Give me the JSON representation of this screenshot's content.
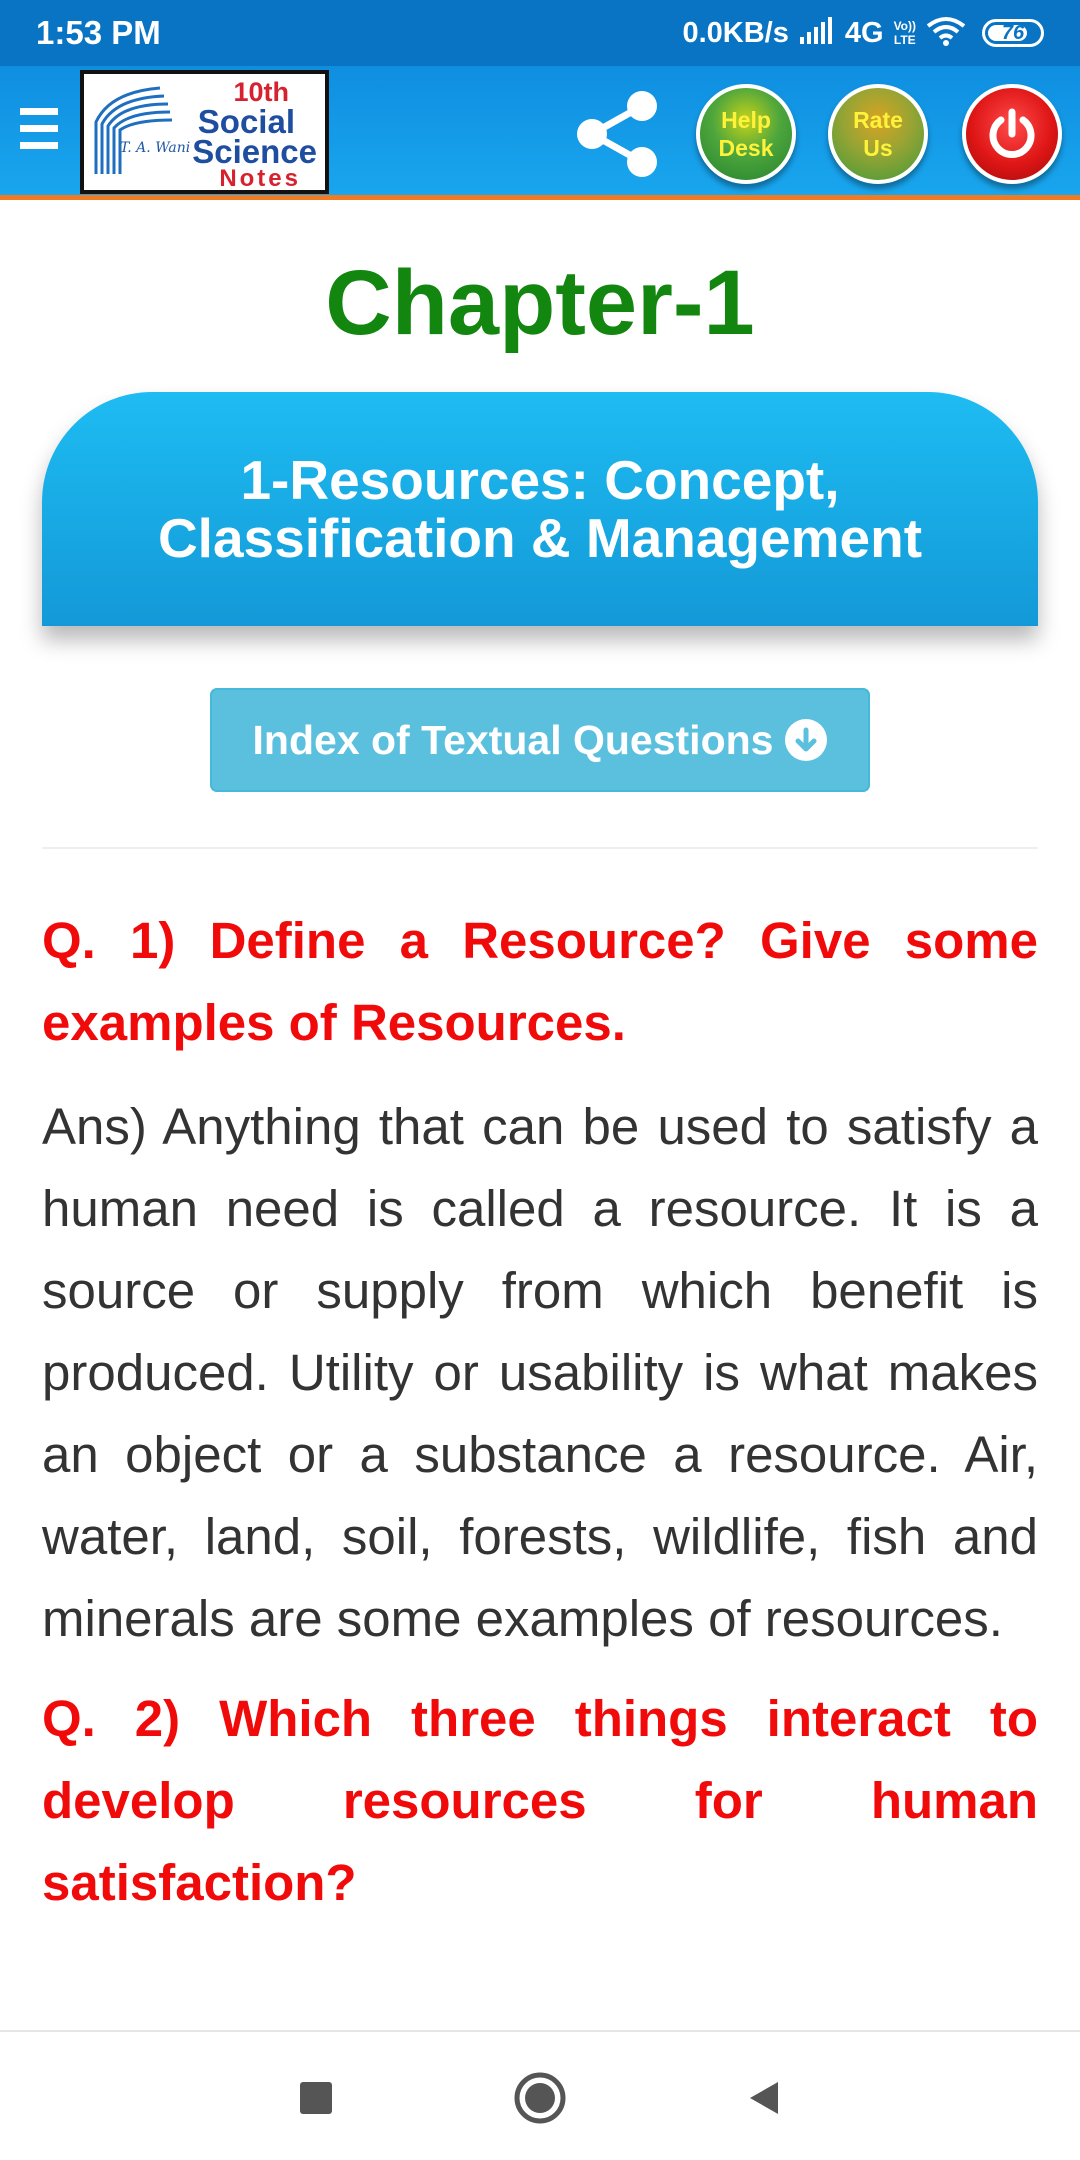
{
  "status_bar": {
    "time": "1:53 PM",
    "net_speed": "0.0KB/s",
    "network_type": "4G",
    "volte_top": "Vo))",
    "volte_bottom": "LTE",
    "battery": "76",
    "icons": [
      "signal-icon",
      "wifi-icon",
      "battery-icon"
    ]
  },
  "app_bar": {
    "logo": {
      "line1": "10th",
      "line2": "Social",
      "line3": "Science",
      "line4": "Notes",
      "author": "T. A. Wani"
    },
    "help_label_1": "Help",
    "help_label_2": "Desk",
    "rate_label_1": "Rate",
    "rate_label_2": "Us",
    "icons": [
      "menu-icon",
      "share-icon",
      "power-icon"
    ]
  },
  "content": {
    "chapter_title": "Chapter-1",
    "topic_title": "1-Resources: Concept, Classification & Management",
    "index_button": "Index of Textual Questions",
    "q1": "Q. 1) Define a Resource? Give some examples of Resources.",
    "a1": "Ans) Anything that can be used to satisfy a human need is called a resource. It is a source or supply from which benefit is produced. Utility or usability is what makes an object or a substance a resource. Air, water, land, soil, forests, wildlife, fish and minerals are some examples of resources.",
    "q2": "Q. 2) Which three things interact to develop resources for human satisfaction?"
  },
  "colors": {
    "status_bar": "#0a74c4",
    "app_bar": "#19a6ee",
    "app_bar_border": "#f07b23",
    "chapter_title": "#12860f",
    "question": "#f10a0a",
    "answer": "#333333",
    "index_button": "#5bc0de"
  },
  "nav_bar": {
    "icons": [
      "recent-apps-icon",
      "home-icon",
      "back-icon"
    ]
  }
}
